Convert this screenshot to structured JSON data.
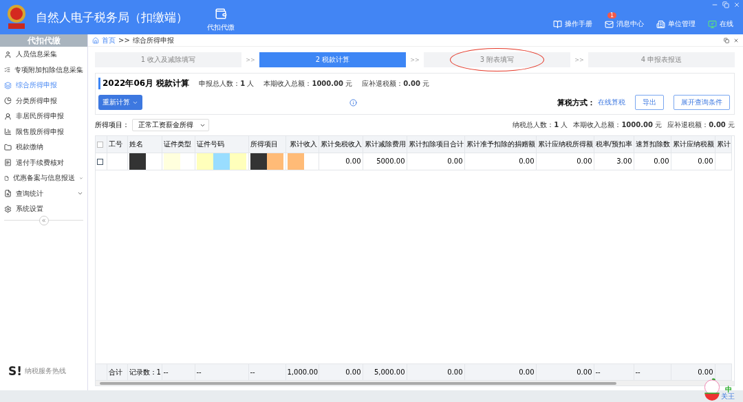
{
  "app": {
    "title": "自然人电子税务局（扣缴端）",
    "module": "代扣代缴",
    "actions": [
      {
        "kind": "manual",
        "label": "操作手册"
      },
      {
        "kind": "message",
        "label": "消息中心",
        "badge": "1"
      },
      {
        "kind": "org",
        "label": "单位管理"
      },
      {
        "kind": "online",
        "label": "在线"
      }
    ]
  },
  "sidebar": {
    "header": "代扣代缴",
    "items": [
      {
        "label": "人员信息采集",
        "selected": false,
        "kind": "link"
      },
      {
        "label": "专项附加扣除信息采集",
        "selected": false,
        "kind": "link"
      },
      {
        "label": "综合所得申报",
        "selected": true,
        "kind": "link"
      },
      {
        "label": "分类所得申报",
        "selected": false,
        "kind": "link"
      },
      {
        "label": "非居民所得申报",
        "selected": false,
        "kind": "link"
      },
      {
        "label": "限售股所得申报",
        "selected": false,
        "kind": "link"
      },
      {
        "label": "税款缴纳",
        "selected": false,
        "kind": "link"
      },
      {
        "label": "退付手续费核对",
        "selected": false,
        "kind": "link"
      },
      {
        "label": "优惠备案与信息报送",
        "selected": false,
        "kind": "group"
      },
      {
        "label": "查询统计",
        "selected": false,
        "kind": "group"
      },
      {
        "label": "系统设置",
        "selected": false,
        "kind": "link"
      }
    ],
    "collapse": "«",
    "hotline": {
      "mark": "S!",
      "label": "纳税服务热线"
    }
  },
  "breadcrumb": [
    {
      "label": "首页",
      "kind": "link"
    },
    {
      "label": ">>",
      "kind": "sep"
    },
    {
      "label": "综合所得申报",
      "kind": "current"
    }
  ],
  "steps": [
    {
      "label": "1 收入及减除填写",
      "selected": false,
      "circled": false,
      "separator": ">>"
    },
    {
      "label": "2 税款计算",
      "selected": true,
      "circled": false,
      "separator": ">>"
    },
    {
      "label": "3 附表填写",
      "selected": false,
      "circled": true,
      "separator": ">>"
    },
    {
      "label": "4 申报表报送",
      "selected": false,
      "circled": false
    }
  ],
  "summary": {
    "title": "2022年06月  税款计算",
    "stats": [
      "申报总人数：**1** 人",
      "本期收入总额：**1000.00** 元",
      "应补退税额：**0.00** 元"
    ],
    "recalc": "重新计算",
    "method_label": "算税方式：",
    "method_value": "在线算税",
    "buttons": [
      "导出",
      "展开查询条件"
    ]
  },
  "filter": {
    "label": "所得项目：",
    "value": "正常工资薪金所得"
  },
  "totals": [
    "纳税总人数：**1** 人",
    "本期收入总额：**1000.00** 元",
    "应补退税额：**0.00** 元"
  ],
  "table": {
    "header_checked": false,
    "columns": [
      "工号",
      "姓名",
      "证件类型",
      "证件号码",
      "所得项目",
      "累计收入",
      "累计免税收入",
      "累计减除费用",
      "累计扣除项目合计",
      "累计准予扣除的捐赠额",
      "累计应纳税所得额",
      "税率/预扣率",
      "速算扣除数",
      "累计应纳税额",
      "累计"
    ],
    "rows": [
      {
        "checked": false,
        "cells": [
          {},
          {
            "redactions": [
              {
                "color": "#333333"
              }
            ]
          },
          {
            "redactions": [
              {
                "color": "#ffffdd"
              }
            ]
          },
          {
            "redactions": [
              {
                "color": "#ffffbb"
              },
              {
                "color": "#99ddff"
              },
              {
                "color": "#ffffbb"
              }
            ]
          },
          {
            "redactions": [
              {
                "color": "#333333"
              },
              {
                "color": "#ffbb77"
              }
            ]
          },
          {
            "redactions": [
              {
                "color": "#ffbb77"
              }
            ]
          },
          {
            "text": "0.00"
          },
          {
            "text": "5000.00"
          },
          {
            "text": "0.00"
          },
          {
            "text": "0.00"
          },
          {
            "text": "0.00"
          },
          {
            "text": "3.00"
          },
          {
            "text": "0.00"
          },
          {
            "text": "0.00"
          },
          {}
        ]
      }
    ],
    "footer": [
      "合计",
      "记录数：1",
      "--",
      "--",
      "--",
      "1,000.00",
      "0.00",
      "5,000.00",
      "0.00",
      "0.00",
      "0.00",
      "--",
      "--",
      "0.00"
    ]
  },
  "ime": "中",
  "status": "关王"
}
